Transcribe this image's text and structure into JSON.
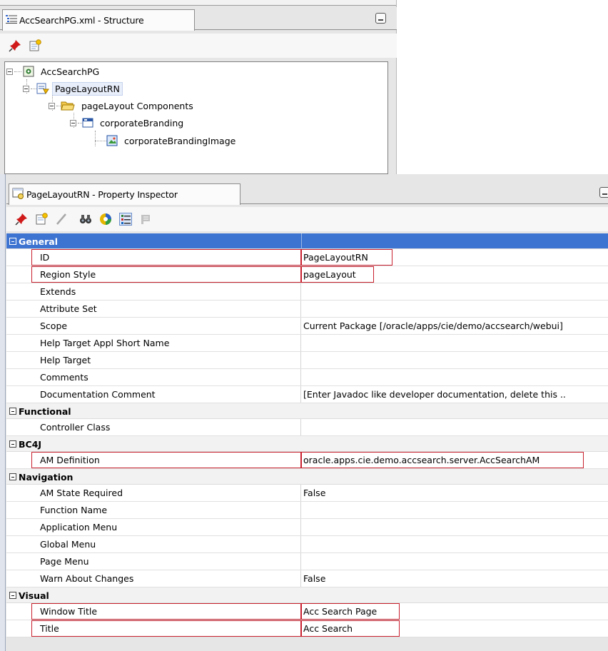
{
  "structure_pane": {
    "tab_title": "AccSearchPG.xml - Structure",
    "tree": [
      {
        "label": "AccSearchPG",
        "icon": "page-icon"
      },
      {
        "label": "PageLayoutRN",
        "icon": "region-icon"
      },
      {
        "label": "pageLayout Components",
        "icon": "folder-icon"
      },
      {
        "label": "corporateBranding",
        "icon": "branding-icon"
      },
      {
        "label": "corporateBrandingImage",
        "icon": "image-icon"
      }
    ]
  },
  "inspector_pane": {
    "tab_title": "PageLayoutRN - Property Inspector",
    "toolbar_icons": [
      "pin-icon",
      "new-icon",
      "edit-pencil-icon",
      "binoculars-icon",
      "color-icon",
      "categorize-icon",
      "toggle-icon"
    ]
  },
  "properties": {
    "general": {
      "label": "General",
      "rows": [
        {
          "name": "ID",
          "value": "PageLayoutRN"
        },
        {
          "name": "Region Style",
          "value": "pageLayout"
        },
        {
          "name": "Extends",
          "value": ""
        },
        {
          "name": "Attribute Set",
          "value": ""
        },
        {
          "name": "Scope",
          "value": "Current Package [/oracle/apps/cie/demo/accsearch/webui]"
        },
        {
          "name": "Help Target Appl Short Name",
          "value": ""
        },
        {
          "name": "Help Target",
          "value": ""
        },
        {
          "name": "Comments",
          "value": ""
        },
        {
          "name": "Documentation Comment",
          "value": "[Enter Javadoc like developer documentation, delete this .."
        }
      ]
    },
    "functional": {
      "label": "Functional",
      "rows": [
        {
          "name": "Controller Class",
          "value": ""
        }
      ]
    },
    "bc4j": {
      "label": "BC4J",
      "rows": [
        {
          "name": "AM Definition",
          "value": "oracle.apps.cie.demo.accsearch.server.AccSearchAM"
        }
      ]
    },
    "navigation": {
      "label": "Navigation",
      "rows": [
        {
          "name": "AM State Required",
          "value": "False"
        },
        {
          "name": "Function Name",
          "value": ""
        },
        {
          "name": "Application Menu",
          "value": ""
        },
        {
          "name": "Global Menu",
          "value": ""
        },
        {
          "name": "Page Menu",
          "value": ""
        },
        {
          "name": "Warn About Changes",
          "value": "False"
        }
      ]
    },
    "visual": {
      "label": "Visual",
      "rows": [
        {
          "name": "Window Title",
          "value": "Acc Search Page"
        },
        {
          "name": "Title",
          "value": "Acc Search"
        }
      ]
    }
  },
  "colors": {
    "selected_category": "#3d73d1",
    "highlight_box": "#c8202e"
  }
}
